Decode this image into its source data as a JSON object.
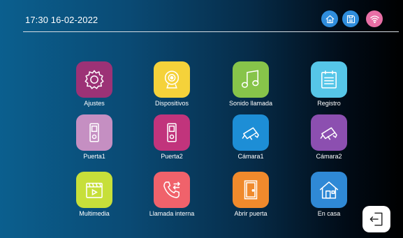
{
  "status": {
    "datetime": "17:30  16-02-2022",
    "icons": [
      {
        "name": "home-status-icon",
        "color": "#2f8ddc"
      },
      {
        "name": "save-icon",
        "color": "#2f8ddc"
      },
      {
        "name": "wifi-icon",
        "color": "#e86fa6"
      }
    ]
  },
  "menu": {
    "tiles": [
      {
        "label": "Ajustes",
        "icon": "gear-icon",
        "color": "#9c3276"
      },
      {
        "label": "Dispositivos",
        "icon": "webcam-icon",
        "color": "#f5d23a"
      },
      {
        "label": "Sonido llamada",
        "icon": "music-note-icon",
        "color": "#87c44a"
      },
      {
        "label": "Registro",
        "icon": "log-icon",
        "color": "#56c6e8"
      },
      {
        "label": "Puerta1",
        "icon": "door-station-icon",
        "color": "#c58fc2"
      },
      {
        "label": "Puerta2",
        "icon": "door-station-icon",
        "color": "#c1347c"
      },
      {
        "label": "Cámara1",
        "icon": "cctv-camera-icon",
        "color": "#1d8ed6"
      },
      {
        "label": "Cámara2",
        "icon": "cctv-camera-icon",
        "color": "#8c4fb0"
      },
      {
        "label": "Multimedia",
        "icon": "clapperboard-icon",
        "color": "#c7df3a"
      },
      {
        "label": "Llamada interna",
        "icon": "phone-transfer-icon",
        "color": "#f0626b"
      },
      {
        "label": "Abrir puerta",
        "icon": "open-door-icon",
        "color": "#f08a2c"
      },
      {
        "label": "En casa",
        "icon": "house-icon",
        "color": "#2f89d6"
      }
    ]
  },
  "exit": {
    "icon": "exit-icon"
  }
}
